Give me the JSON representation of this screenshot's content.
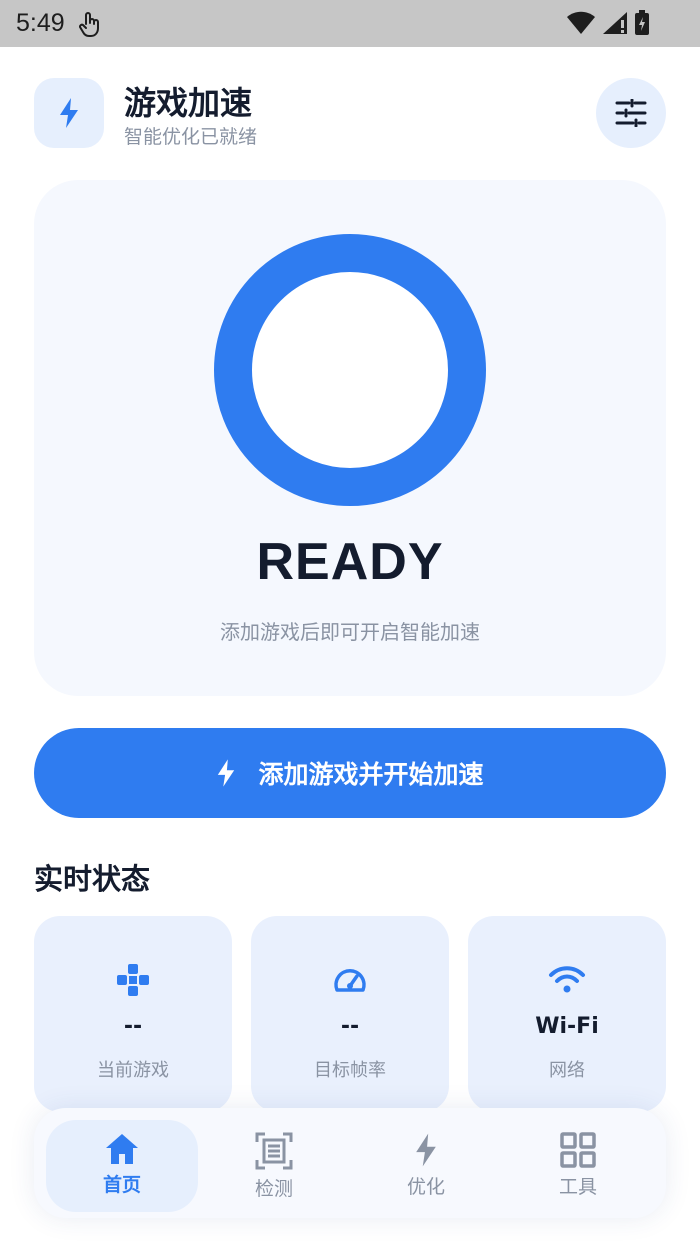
{
  "status_bar": {
    "time": "5:49"
  },
  "header": {
    "title": "游戏加速",
    "subtitle": "智能优化已就绪",
    "badge_icon": "lightning-icon",
    "settings_icon": "sliders-icon"
  },
  "hero": {
    "status": "READY",
    "hint": "添加游戏后即可开启智能加速"
  },
  "primary_button": {
    "label": "添加游戏并开始加速",
    "icon": "lightning-icon"
  },
  "section": {
    "title": "实时状态"
  },
  "stats": [
    {
      "icon": "gamepad-icon",
      "value": "--",
      "label": "当前游戏"
    },
    {
      "icon": "speedometer-icon",
      "value": "--",
      "label": "目标帧率"
    },
    {
      "icon": "wifi-icon",
      "value": "Wi-Fi",
      "label": "网络"
    }
  ],
  "nav": [
    {
      "label": "首页",
      "icon": "home-icon",
      "active": true
    },
    {
      "label": "检测",
      "icon": "scan-icon",
      "active": false
    },
    {
      "label": "优化",
      "icon": "lightning-icon",
      "active": false
    },
    {
      "label": "工具",
      "icon": "grid-icon",
      "active": false
    }
  ],
  "colors": {
    "accent": "#2f7cf0",
    "tint": "#e6effd",
    "text": "#141c2e",
    "muted": "#8a93a3"
  }
}
